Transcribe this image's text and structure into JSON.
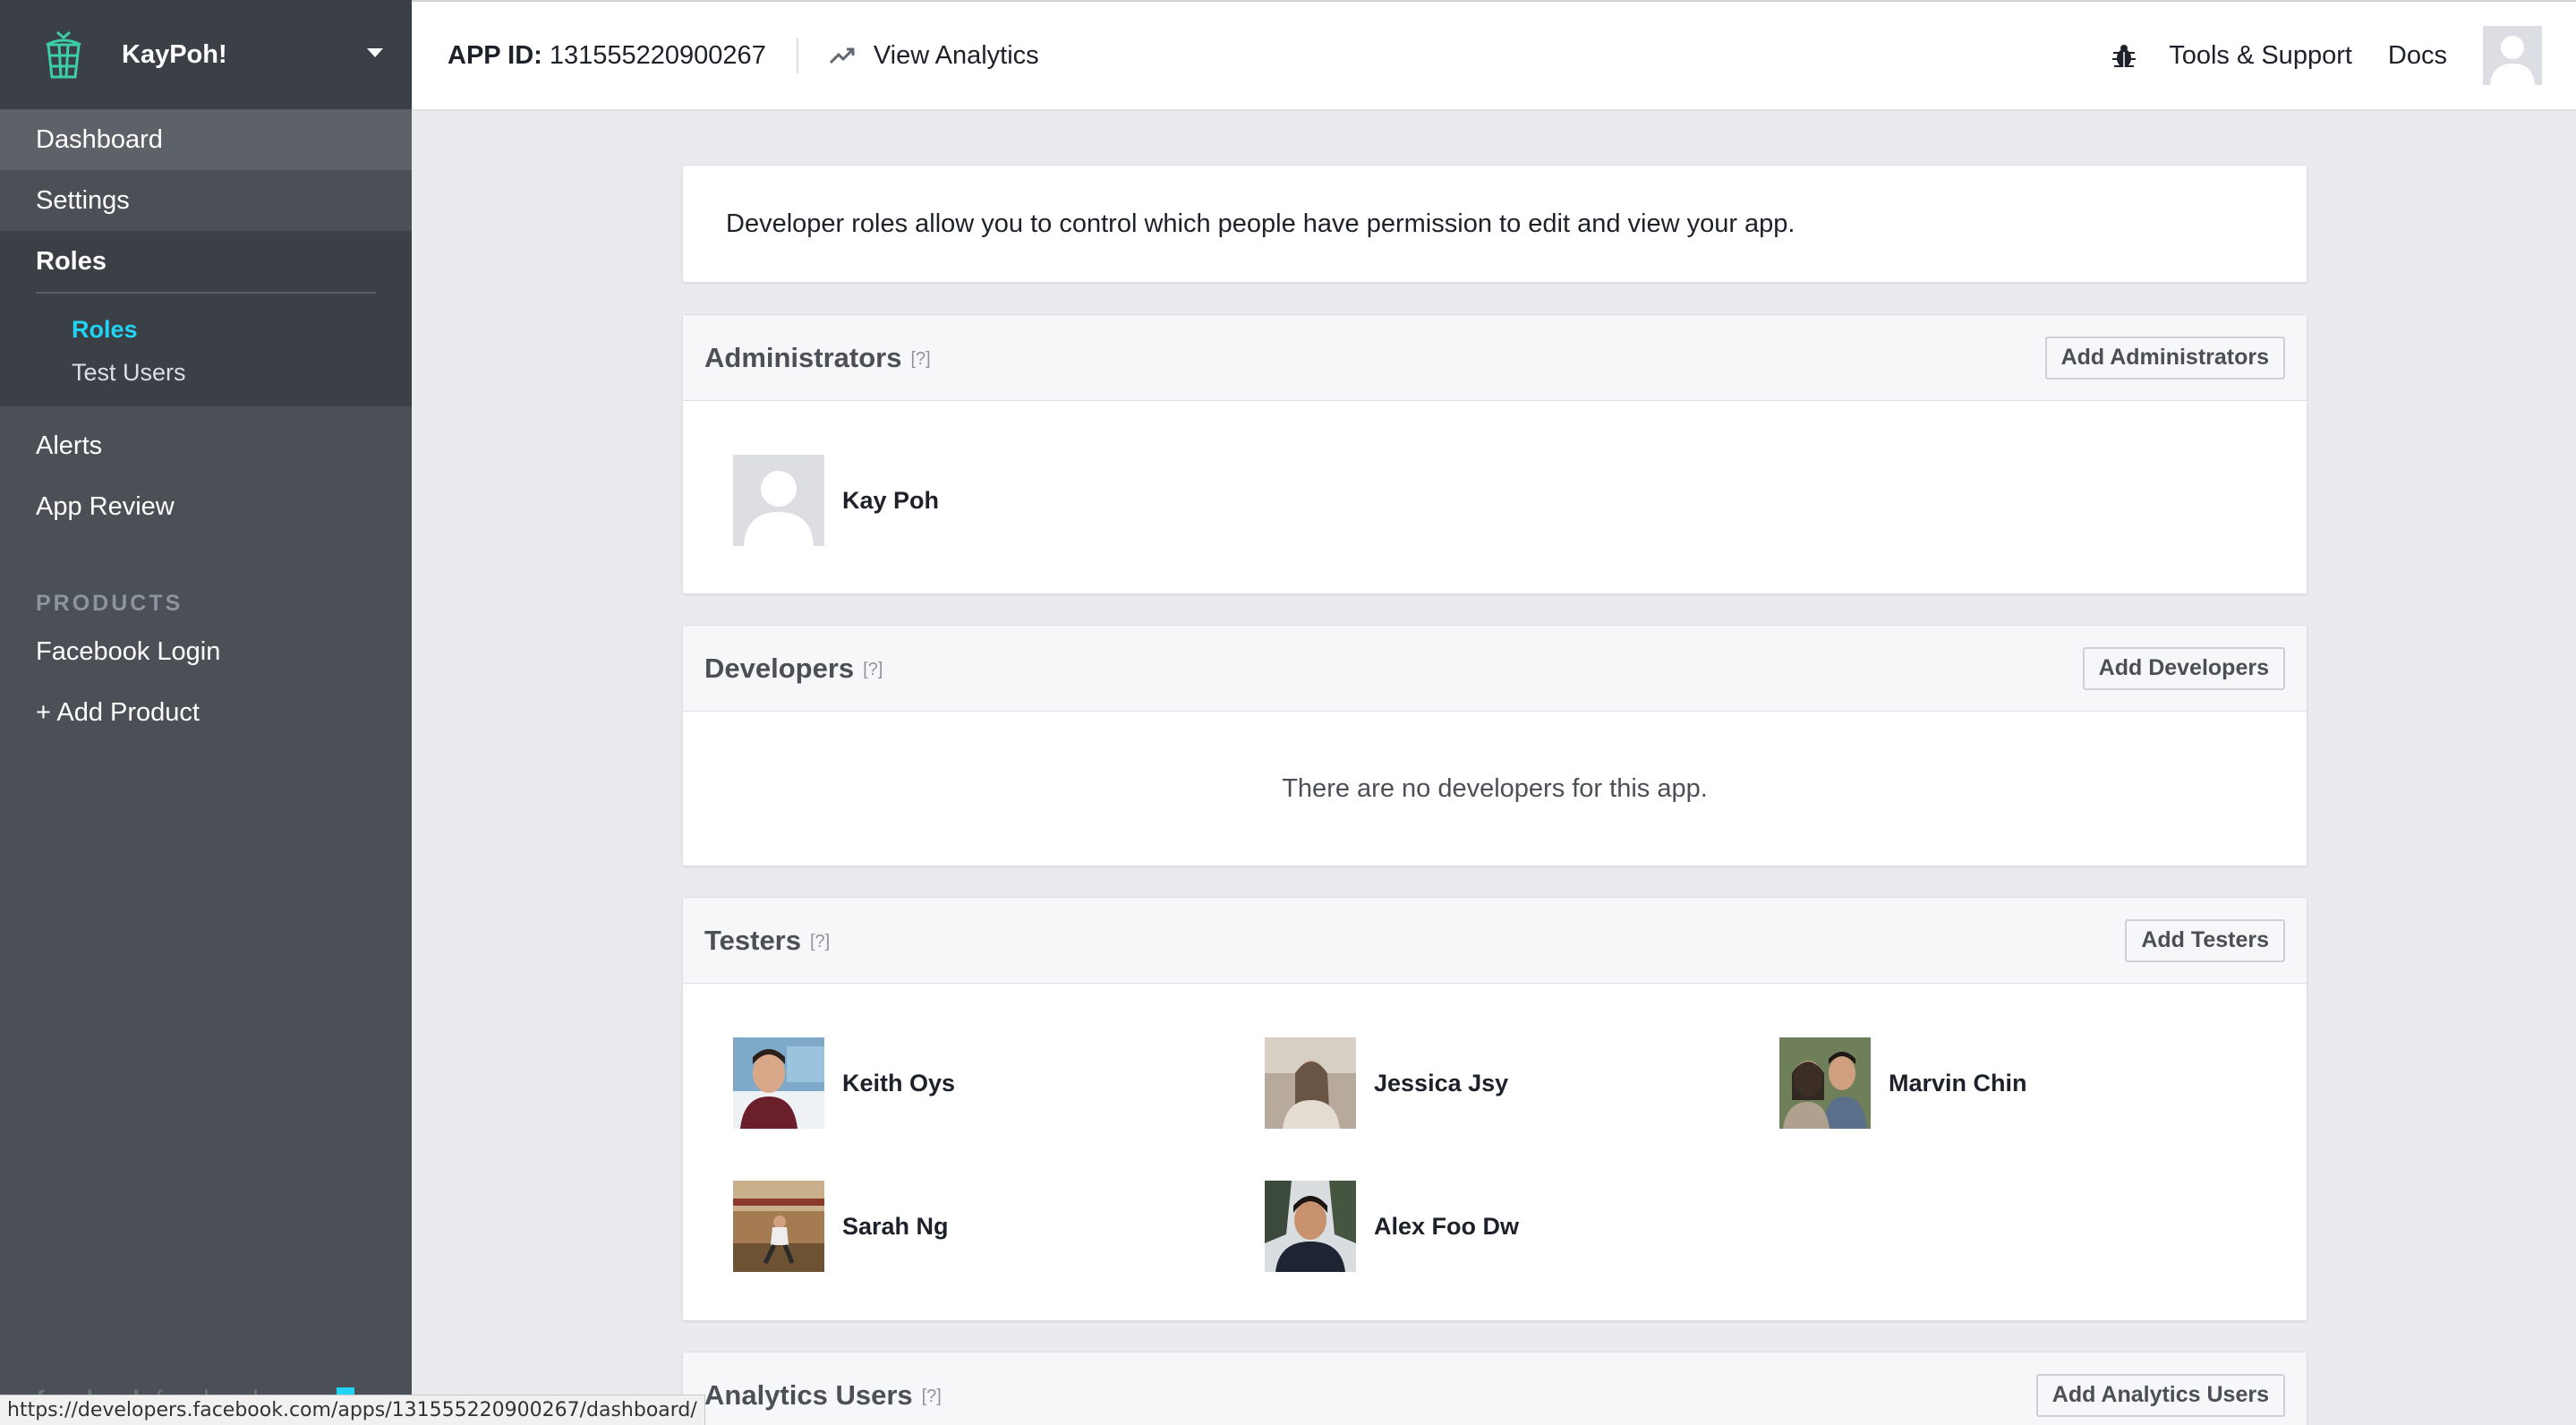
{
  "app": {
    "name": "KayPoh!"
  },
  "sidebar": {
    "items": [
      {
        "label": "Dashboard"
      },
      {
        "label": "Settings"
      },
      {
        "label": "Roles"
      }
    ],
    "roles_sub": [
      {
        "label": "Roles"
      },
      {
        "label": "Test Users"
      }
    ],
    "more": [
      {
        "label": "Alerts"
      },
      {
        "label": "App Review"
      }
    ],
    "products_heading": "PRODUCTS",
    "products": [
      {
        "label": "Facebook Login"
      },
      {
        "label": "+ Add Product"
      }
    ],
    "footer_brand": "facebook",
    "footer_text": "for developers"
  },
  "topbar": {
    "app_id_label": "APP ID:",
    "app_id_value": "131555220900267",
    "view_analytics": "View Analytics",
    "tools_support": "Tools & Support",
    "docs": "Docs"
  },
  "intro_text": "Developer roles allow you to control which people have permission to edit and view your app.",
  "administrators": {
    "title": "Administrators",
    "help": "[?]",
    "button": "Add Administrators",
    "people": [
      {
        "name": "Kay Poh"
      }
    ]
  },
  "developers": {
    "title": "Developers",
    "help": "[?]",
    "button": "Add Developers",
    "empty": "There are no developers for this app."
  },
  "testers": {
    "title": "Testers",
    "help": "[?]",
    "button": "Add Testers",
    "people": [
      {
        "name": "Keith Oys"
      },
      {
        "name": "Jessica Jsy"
      },
      {
        "name": "Marvin Chin"
      },
      {
        "name": "Sarah Ng"
      },
      {
        "name": "Alex Foo Dw"
      }
    ]
  },
  "analytics_users": {
    "title": "Analytics Users",
    "help": "[?]",
    "button": "Add Analytics Users"
  },
  "status_url": "https://developers.facebook.com/apps/131555220900267/dashboard/",
  "colors": {
    "sidebar_bg": "#4b4f56",
    "sidebar_dark": "#3b3f46",
    "accent": "#21d3f5",
    "page_bg": "#e9ebee"
  }
}
